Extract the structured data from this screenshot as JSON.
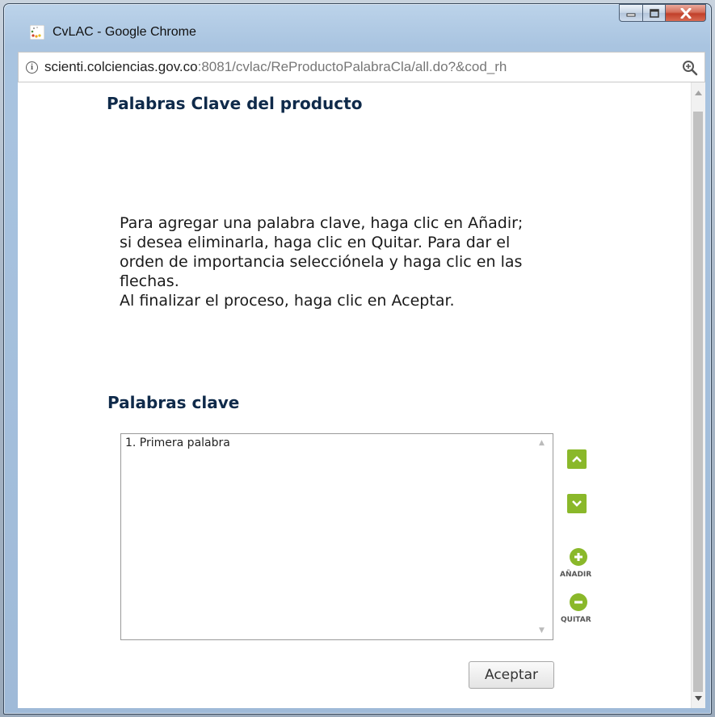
{
  "window": {
    "title": "CvLAC - Google Chrome"
  },
  "address": {
    "host": "scienti.colciencias.gov.co",
    "path": ":8081/cvlac/ReProductoPalabraCla/all.do?&cod_rh"
  },
  "page": {
    "heading": "Palabras Clave del producto",
    "instructions": [
      "Para agregar una palabra clave, haga clic en Añadir;",
      "si desea eliminarla, haga clic en Quitar. Para dar el",
      "orden de importancia selecciónela y haga clic en las",
      "flechas.",
      "Al finalizar el proceso, haga clic en Aceptar."
    ],
    "keywords_heading": "Palabras clave",
    "keywords": [
      "1. Primera palabra"
    ],
    "add_label": "AÑADIR",
    "remove_label": "QUITAR",
    "accept_label": "Aceptar"
  },
  "colors": {
    "accent_green": "#8ab82a",
    "heading_navy": "#0f2a4a"
  },
  "icons": [
    "chrome-icon",
    "minimize-icon",
    "maximize-icon",
    "close-icon",
    "info-icon",
    "zoom-icon",
    "arrow-up-icon",
    "arrow-down-icon",
    "plus-circle-icon",
    "minus-circle-icon"
  ]
}
